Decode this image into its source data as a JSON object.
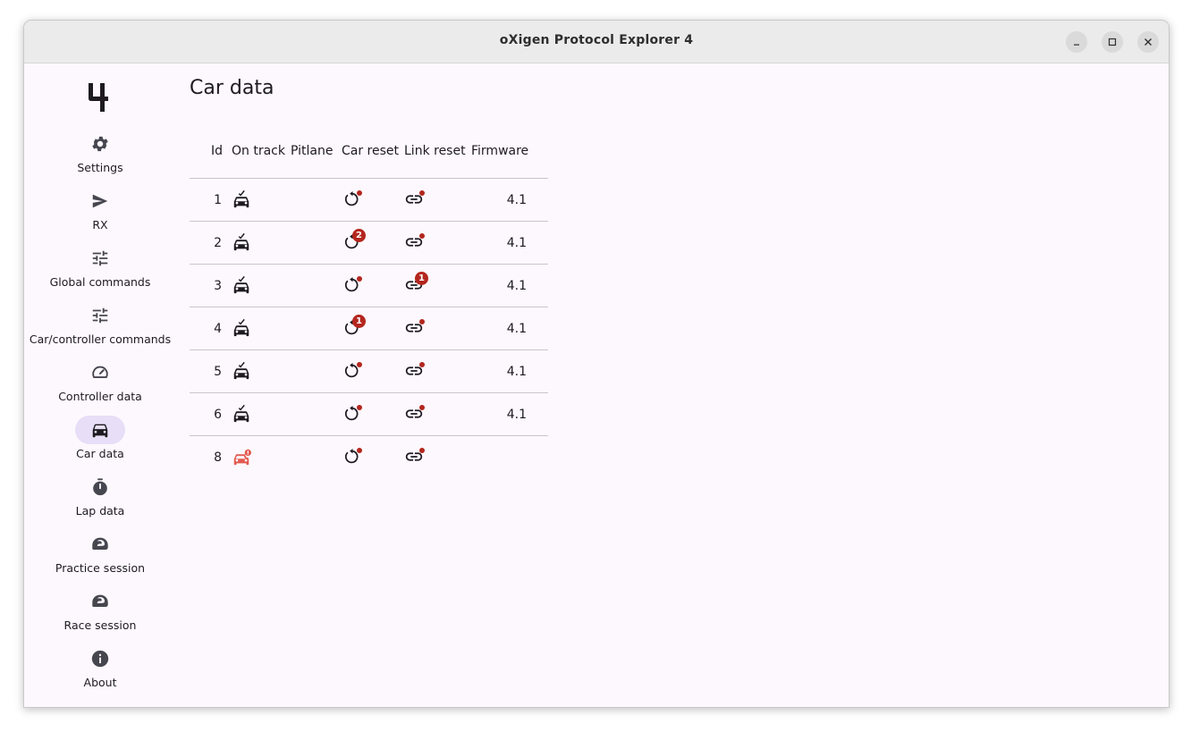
{
  "window": {
    "title": "oXigen Protocol Explorer 4"
  },
  "titlebar_buttons": [
    {
      "name": "minimize-button",
      "icon": "minimize-icon"
    },
    {
      "name": "maximize-button",
      "icon": "maximize-icon"
    },
    {
      "name": "close-button",
      "icon": "close-icon"
    }
  ],
  "app_logo": {
    "icon": "app-logo-4"
  },
  "nav": {
    "selected": "Car data",
    "items": [
      {
        "label": "Settings",
        "icon": "gear-icon"
      },
      {
        "label": "RX",
        "icon": "send-icon"
      },
      {
        "label": "Global commands",
        "icon": "tune-icon"
      },
      {
        "label": "Car/controller commands",
        "icon": "tune-icon"
      },
      {
        "label": "Controller data",
        "icon": "speedometer-icon"
      },
      {
        "label": "Car data",
        "icon": "car-icon"
      },
      {
        "label": "Lap data",
        "icon": "timer-icon"
      },
      {
        "label": "Practice session",
        "icon": "helmet-icon"
      },
      {
        "label": "Race session",
        "icon": "helmet-icon"
      },
      {
        "label": "About",
        "icon": "info-icon"
      }
    ]
  },
  "main": {
    "title": "Car data",
    "table": {
      "headers": [
        "Id",
        "On track",
        "Pitlane",
        "Car reset",
        "Link reset",
        "Firmware"
      ],
      "rows": [
        {
          "id": "1",
          "on_track": "car-on-track-icon",
          "pitlane": "",
          "car_reset_badge": "",
          "link_reset_badge": "",
          "firmware": "4.1"
        },
        {
          "id": "2",
          "on_track": "car-on-track-icon",
          "pitlane": "",
          "car_reset_badge": "2",
          "link_reset_badge": "",
          "firmware": "4.1"
        },
        {
          "id": "3",
          "on_track": "car-on-track-icon",
          "pitlane": "",
          "car_reset_badge": "",
          "link_reset_badge": "1",
          "firmware": "4.1"
        },
        {
          "id": "4",
          "on_track": "car-on-track-icon",
          "pitlane": "",
          "car_reset_badge": "1",
          "link_reset_badge": "",
          "firmware": "4.1"
        },
        {
          "id": "5",
          "on_track": "car-on-track-icon",
          "pitlane": "",
          "car_reset_badge": "",
          "link_reset_badge": "",
          "firmware": "4.1"
        },
        {
          "id": "6",
          "on_track": "car-on-track-icon",
          "pitlane": "",
          "car_reset_badge": "",
          "link_reset_badge": "",
          "firmware": "4.1"
        },
        {
          "id": "8",
          "on_track": "car-error-icon",
          "pitlane": "",
          "car_reset_badge": "",
          "link_reset_badge": "",
          "firmware": ""
        }
      ]
    }
  },
  "colors": {
    "accent_pill": "#e8def8",
    "error": "#b3261e",
    "car_error": "#e35a4f",
    "background": "#fdf8fd"
  }
}
